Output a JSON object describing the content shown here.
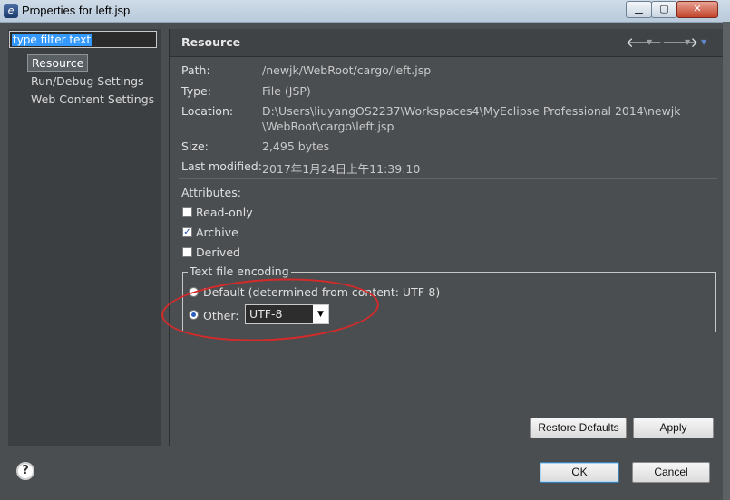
{
  "window": {
    "title": "Properties for left.jsp"
  },
  "filter": {
    "text": "type filter text"
  },
  "tree": [
    "Resource",
    "Run/Debug Settings",
    "Web Content Settings"
  ],
  "header": {
    "title": "Resource"
  },
  "info": {
    "path_label": "Path:",
    "path": "/newjk/WebRoot/cargo/left.jsp",
    "type_label": "Type:",
    "type": "File  (JSP)",
    "location_label": "Location:",
    "location_line1": "D:\\Users\\liuyangOS2237\\Workspaces4\\MyEclipse Professional 2014\\newjk",
    "location_line2": "\\WebRoot\\cargo\\left.jsp",
    "size_label": "Size:",
    "size": "2,495  bytes",
    "modified_label": "Last modified:",
    "modified": "2017年1月24日上午11:39:10"
  },
  "attributes": {
    "heading": "Attributes:",
    "items": [
      {
        "label": "Read-only",
        "checked": false
      },
      {
        "label": "Archive",
        "checked": true
      },
      {
        "label": "Derived",
        "checked": false
      }
    ]
  },
  "encoding": {
    "group_label": "Text file encoding",
    "default_label": "Default (determined from content: UTF-8)",
    "other_label": "Other:",
    "other_value": "UTF-8",
    "selected": "other"
  },
  "buttons": {
    "restore": "Restore Defaults",
    "apply": "Apply",
    "ok": "OK",
    "cancel": "Cancel",
    "help": "?"
  },
  "icons": {
    "app": "eclipse-icon",
    "back": "arrow-left-icon",
    "forward": "arrow-right-icon",
    "menu": "view-menu-icon",
    "help": "help-icon",
    "dropdown": "chevron-down-icon"
  },
  "colors": {
    "annotation": "#d42a2a",
    "selection": "#3399ff"
  }
}
